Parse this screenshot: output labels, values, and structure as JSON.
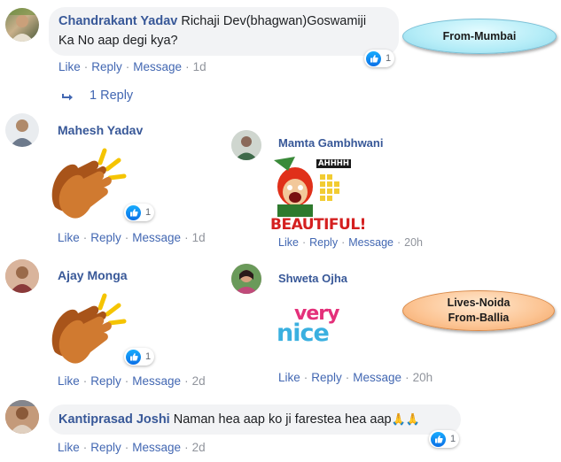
{
  "actions": {
    "like": "Like",
    "reply": "Reply",
    "message": "Message",
    "sep": "·"
  },
  "comments": [
    {
      "name": "Chandrakant Yadav",
      "text_line1": "Richaji Dev(bhagwan)Goswamiji",
      "text_line2": "Ka No aap degi kya?",
      "time": "1d",
      "reactions": "1",
      "replies_label": "1 Reply"
    },
    {
      "name": "Mahesh Yadav",
      "sticker": "clapping-hands",
      "time": "1d",
      "reactions": "1"
    },
    {
      "name": "Mamta Gambhwani",
      "sticker": "beautiful-sticker",
      "sticker_shout": "AHHHH",
      "sticker_text": "BEAUTIFUL!",
      "time": "20h"
    },
    {
      "name": "Ajay Monga",
      "sticker": "clapping-hands",
      "time": "2d",
      "reactions": "1"
    },
    {
      "name": "Shweta Ojha",
      "sticker": "very-nice-sticker",
      "sticker_text_top": "very",
      "sticker_text_bottom": "nice",
      "time": "20h"
    },
    {
      "name": "Kantiprasad Joshi",
      "text": "Naman hea aap ko ji farestea hea aap",
      "emoji": "🙏🙏",
      "time": "2d",
      "reactions": "1"
    }
  ],
  "callouts": {
    "mumbai": "From-Mumbai",
    "noida_line1": "Lives-Noida",
    "noida_line2": "From-Ballia"
  },
  "colors": {
    "link": "#4267b2",
    "name": "#385898",
    "meta": "#90949c",
    "bubble": "#f2f3f5",
    "like_blue": "#1877f2"
  },
  "icons": [
    "like-icon",
    "reply-arrow-icon",
    "clapping-hands-icon"
  ]
}
